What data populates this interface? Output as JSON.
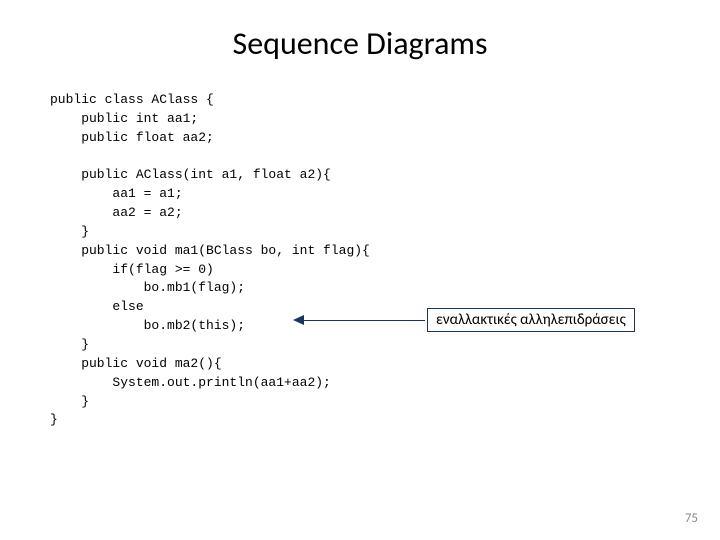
{
  "title": "Sequence Diagrams",
  "code": "public class AClass {\n    public int aa1;\n    public float aa2;\n\n    public AClass(int a1, float a2){\n        aa1 = a1;\n        aa2 = a2;\n    }\n    public void ma1(BClass bo, int flag){\n        if(flag >= 0)\n            bo.mb1(flag);\n        else\n            bo.mb2(this);\n    }\n    public void ma2(){\n        System.out.println(aa1+aa2);\n    }\n}",
  "annotation": "εναλλακτικές αλληλεπιδράσεις",
  "page_number": "75"
}
